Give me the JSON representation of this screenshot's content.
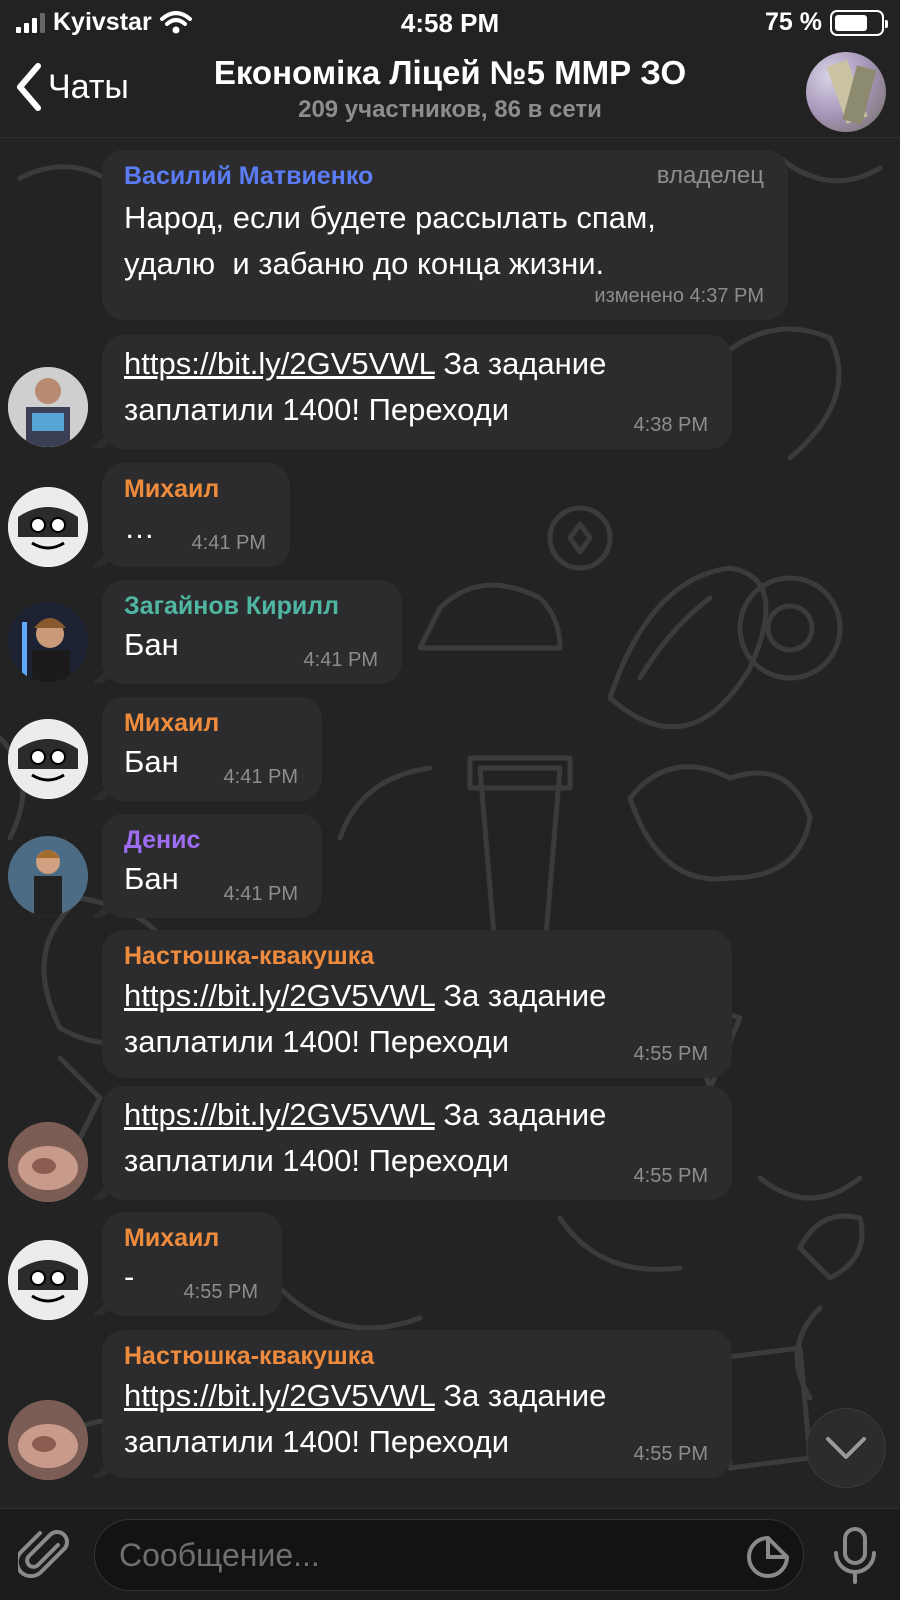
{
  "status_bar": {
    "carrier": "Kyivstar",
    "time": "4:58 PM",
    "battery_text": "75 %",
    "battery_level": 0.75
  },
  "header": {
    "back_label": "Чаты",
    "title": "Економіка Ліцей №5 ММР ЗО",
    "subtitle": "209 участников, 86 в сети"
  },
  "colors": {
    "name_blue": "#5b7cf5",
    "name_orange": "#ef8b3d",
    "name_teal": "#4fb6a1",
    "name_purple": "#9f6df2",
    "bubble": "#2c2c2e"
  },
  "messages": [
    {
      "sender": "Василий Матвиенко",
      "role": "владелец",
      "link": "",
      "text": "Народ, если будете рассылать спам,\nудалю  и забаню до конца жизни.",
      "time": "изменено 4:37 PM"
    },
    {
      "sender": "",
      "link": "https://bit.ly/2GV5VWL",
      "text": " За задание\nзаплатили 1400! Переходи",
      "time": "4:38 PM"
    },
    {
      "sender": "Михаил",
      "link": "",
      "text": "…",
      "time": "4:41 PM"
    },
    {
      "sender": "Загайнов Кирилл",
      "link": "",
      "text": "Бан",
      "time": "4:41 PM"
    },
    {
      "sender": "Михаил",
      "link": "",
      "text": "Бан",
      "time": "4:41 PM"
    },
    {
      "sender": "Денис",
      "link": "",
      "text": "Бан",
      "time": "4:41 PM"
    },
    {
      "sender": "Настюшка-квакушка",
      "link": "https://bit.ly/2GV5VWL",
      "text": " За задание\nзаплатили 1400! Переходи",
      "time": "4:55 PM"
    },
    {
      "sender": "",
      "link": "https://bit.ly/2GV5VWL",
      "text": " За задание\nзаплатили 1400! Переходи",
      "time": "4:55 PM"
    },
    {
      "sender": "Михаил",
      "link": "",
      "text": "-",
      "time": "4:55 PM"
    },
    {
      "sender": "Настюшка-квакушка",
      "link": "https://bit.ly/2GV5VWL",
      "text": " За задание\nзаплатили 1400! Переходи",
      "time": "4:55 PM"
    }
  ],
  "input": {
    "placeholder": "Сообщение..."
  },
  "icons": [
    "signal-icon",
    "wifi-icon",
    "battery-icon",
    "back-chevron-icon",
    "attach-icon",
    "sticker-icon",
    "microphone-icon",
    "chevron-down-icon"
  ]
}
